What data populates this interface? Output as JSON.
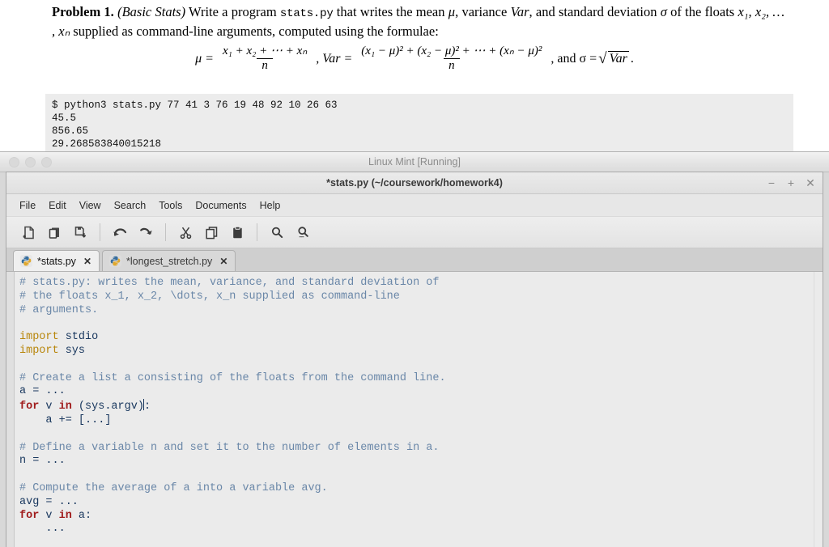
{
  "document": {
    "problem_label": "Problem 1.",
    "problem_topic": "(Basic Stats)",
    "body_1": " Write a program ",
    "inline_code": "stats.py",
    "body_2": " that writes the mean ",
    "sym_mu": "μ",
    "body_3": ", variance ",
    "sym_var": "Var",
    "body_4": ", and standard deviation ",
    "sym_sigma": "σ",
    "body_5": " of the floats ",
    "floats_list": "x₁, x₂, … , xₙ",
    "body_6": " supplied as command-line arguments, computed using the formulae:",
    "formula": {
      "mu_lhs": "μ =",
      "mu_num": "x₁ + x₂ + ⋯ + xₙ",
      "mu_den": "n",
      "sep_1": ", Var =",
      "var_num": "(x₁ − μ)² + (x₂ − μ)² + ⋯ + (xₙ − μ)²",
      "var_den": "n",
      "tail": ",  and σ =",
      "sqrt_body": "Var",
      "period": "."
    },
    "transcript": [
      "$ python3 stats.py 77 41 3 76 19 48 92 10 26 63",
      "45.5",
      "856.65",
      "29.268583840015218"
    ]
  },
  "vm": {
    "title": "Linux Mint [Running]",
    "dots": [
      "close-dot",
      "minimize-dot",
      "zoom-dot"
    ]
  },
  "app": {
    "title": "*stats.py (~/coursework/homework4)",
    "window_controls": {
      "minimize": "−",
      "maximize": "+",
      "close": "✕"
    },
    "menu": [
      {
        "label": "File"
      },
      {
        "label": "Edit"
      },
      {
        "label": "View"
      },
      {
        "label": "Search"
      },
      {
        "label": "Tools"
      },
      {
        "label": "Documents"
      },
      {
        "label": "Help"
      }
    ],
    "toolbar": [
      {
        "icon": "new-document-icon",
        "label": "New"
      },
      {
        "icon": "open-folder-icon",
        "label": "Open"
      },
      {
        "icon": "save-icon",
        "label": "Save"
      },
      {
        "icon": "undo-icon",
        "label": "Undo"
      },
      {
        "icon": "redo-icon",
        "label": "Redo"
      },
      {
        "icon": "cut-scissors-icon",
        "label": "Cut"
      },
      {
        "icon": "copy-icon",
        "label": "Copy"
      },
      {
        "icon": "paste-clipboard-icon",
        "label": "Paste"
      },
      {
        "icon": "find-magnifier-icon",
        "label": "Find"
      },
      {
        "icon": "replace-magnifier-icon",
        "label": "Replace"
      }
    ],
    "tabs": [
      {
        "label": "*stats.py",
        "icon": "python-file-icon",
        "close": "✕",
        "active": true
      },
      {
        "label": "*longest_stretch.py",
        "icon": "python-file-icon",
        "close": "✕",
        "active": false
      }
    ],
    "editor": {
      "lines": [
        {
          "segments": [
            {
              "t": "# stats.py: writes the mean, variance, and standard deviation of",
              "c": "cmt"
            }
          ]
        },
        {
          "segments": [
            {
              "t": "# the floats x_1, x_2, \\dots, x_n supplied as command-line",
              "c": "cmt"
            }
          ]
        },
        {
          "segments": [
            {
              "t": "# arguments.",
              "c": "cmt"
            }
          ]
        },
        {
          "segments": [
            {
              "t": "",
              "c": "plain"
            }
          ]
        },
        {
          "segments": [
            {
              "t": "import",
              "c": "imp"
            },
            {
              "t": " stdio",
              "c": "plain"
            }
          ]
        },
        {
          "segments": [
            {
              "t": "import",
              "c": "imp"
            },
            {
              "t": " sys",
              "c": "plain"
            }
          ]
        },
        {
          "segments": [
            {
              "t": "",
              "c": "plain"
            }
          ]
        },
        {
          "segments": [
            {
              "t": "# Create a list a consisting of the floats from the command line.",
              "c": "cmt"
            }
          ]
        },
        {
          "segments": [
            {
              "t": "a = ...",
              "c": "plain"
            }
          ]
        },
        {
          "segments": [
            {
              "t": "for",
              "c": "kw"
            },
            {
              "t": " v ",
              "c": "plain"
            },
            {
              "t": "in",
              "c": "kw"
            },
            {
              "t": " (sys.argv)",
              "c": "plain"
            },
            {
              "t": "│",
              "c": "caret"
            },
            {
              "t": ":",
              "c": "plain"
            }
          ]
        },
        {
          "segments": [
            {
              "t": "    a += [...]",
              "c": "plain"
            }
          ]
        },
        {
          "segments": [
            {
              "t": "",
              "c": "plain"
            }
          ]
        },
        {
          "segments": [
            {
              "t": "# Define a variable n and set it to the number of elements in a.",
              "c": "cmt"
            }
          ]
        },
        {
          "segments": [
            {
              "t": "n = ...",
              "c": "plain"
            }
          ]
        },
        {
          "segments": [
            {
              "t": "",
              "c": "plain"
            }
          ]
        },
        {
          "segments": [
            {
              "t": "# Compute the average of a into a variable avg.",
              "c": "cmt"
            }
          ]
        },
        {
          "segments": [
            {
              "t": "avg = ...",
              "c": "plain"
            }
          ]
        },
        {
          "segments": [
            {
              "t": "for",
              "c": "kw"
            },
            {
              "t": " v ",
              "c": "plain"
            },
            {
              "t": "in",
              "c": "kw"
            },
            {
              "t": " a:",
              "c": "plain"
            }
          ]
        },
        {
          "segments": [
            {
              "t": "    ...",
              "c": "plain"
            }
          ]
        }
      ]
    }
  },
  "colors": {
    "comment": "#6a87a8",
    "keyword": "#a01c1c",
    "import_keyword": "#b8860b",
    "code_text": "#17365d",
    "editor_bg": "#ebebeb",
    "chrome_bg": "#e7e7e7",
    "vm_title_text": "#8c8c8c"
  }
}
